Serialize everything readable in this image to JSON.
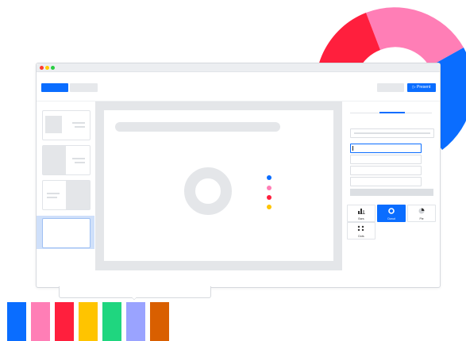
{
  "window": {
    "controls": [
      "close",
      "minimize",
      "maximize"
    ],
    "control_colors": [
      "#ff3b30",
      "#ffcc00",
      "#28cd41"
    ]
  },
  "toolbar": {
    "present_label": "▷ Present",
    "accent": "#0a6dff"
  },
  "slides": {
    "count": 4,
    "selected_index": 3
  },
  "canvas": {
    "legend_colors": [
      "#0a6dff",
      "#ff7eb6",
      "#ff1f3d",
      "#ffc400"
    ]
  },
  "inspector": {
    "chart_types": [
      {
        "label": "Bars",
        "icon": "bar-chart-icon",
        "active": false
      },
      {
        "label": "Donut",
        "icon": "donut-chart-icon",
        "active": true
      },
      {
        "label": "Pie",
        "icon": "pie-chart-icon",
        "active": false
      },
      {
        "label": "Dots",
        "icon": "dots-chart-icon",
        "active": false
      }
    ]
  },
  "decor": {
    "donut_colors": [
      "#0a6dff",
      "#ff1f3d",
      "#ff7eb6"
    ]
  },
  "palette": {
    "swatches": [
      "#0a6dff",
      "#ff7eb6",
      "#ff1f3d",
      "#ffc400",
      "#1fd67f",
      "#9aa3ff",
      "#d95f00"
    ]
  }
}
